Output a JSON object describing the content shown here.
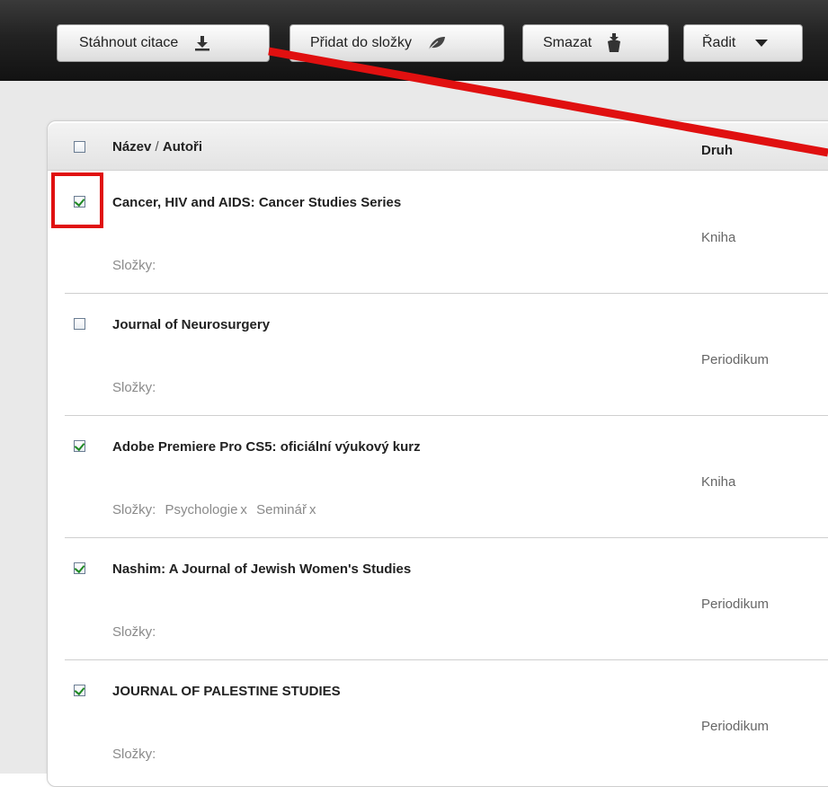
{
  "toolbar": {
    "download_label": "Stáhnout citace",
    "folder_label": "Přidat do složky",
    "delete_label": "Smazat",
    "sort_label": "Řadit"
  },
  "header": {
    "title_col": "Název",
    "separator": " / ",
    "authors_col": "Autoři",
    "kind_col": "Druh"
  },
  "rows": [
    {
      "title": "Cancer, HIV and AIDS: Cancer Studies Series",
      "kind": "Kniha",
      "folders_label": "Složky:",
      "checked": true,
      "tags": []
    },
    {
      "title": "Journal of Neurosurgery",
      "kind": "Periodikum",
      "folders_label": "Složky:",
      "checked": false,
      "tags": []
    },
    {
      "title": "Adobe Premiere Pro CS5: oficiální výukový kurz",
      "kind": "Kniha",
      "folders_label": "Složky:",
      "checked": true,
      "tags": [
        {
          "name": "Psychologie",
          "remove": "x"
        },
        {
          "name": "Seminář",
          "remove": "x"
        }
      ]
    },
    {
      "title": "Nashim: A Journal of Jewish Women's Studies",
      "kind": "Periodikum",
      "folders_label": "Složky:",
      "checked": true,
      "tags": []
    },
    {
      "title": "JOURNAL OF PALESTINE STUDIES",
      "kind": "Periodikum",
      "folders_label": "Složky:",
      "checked": true,
      "tags": []
    }
  ],
  "colors": {
    "toolbar_bg": "#1e1e1e",
    "annotation_red": "#e01010",
    "check_green": "#1f8a23"
  },
  "icons": {
    "download": "download-icon",
    "folder": "leaf-icon",
    "delete": "trash-icon",
    "sort": "caret-down-icon"
  }
}
